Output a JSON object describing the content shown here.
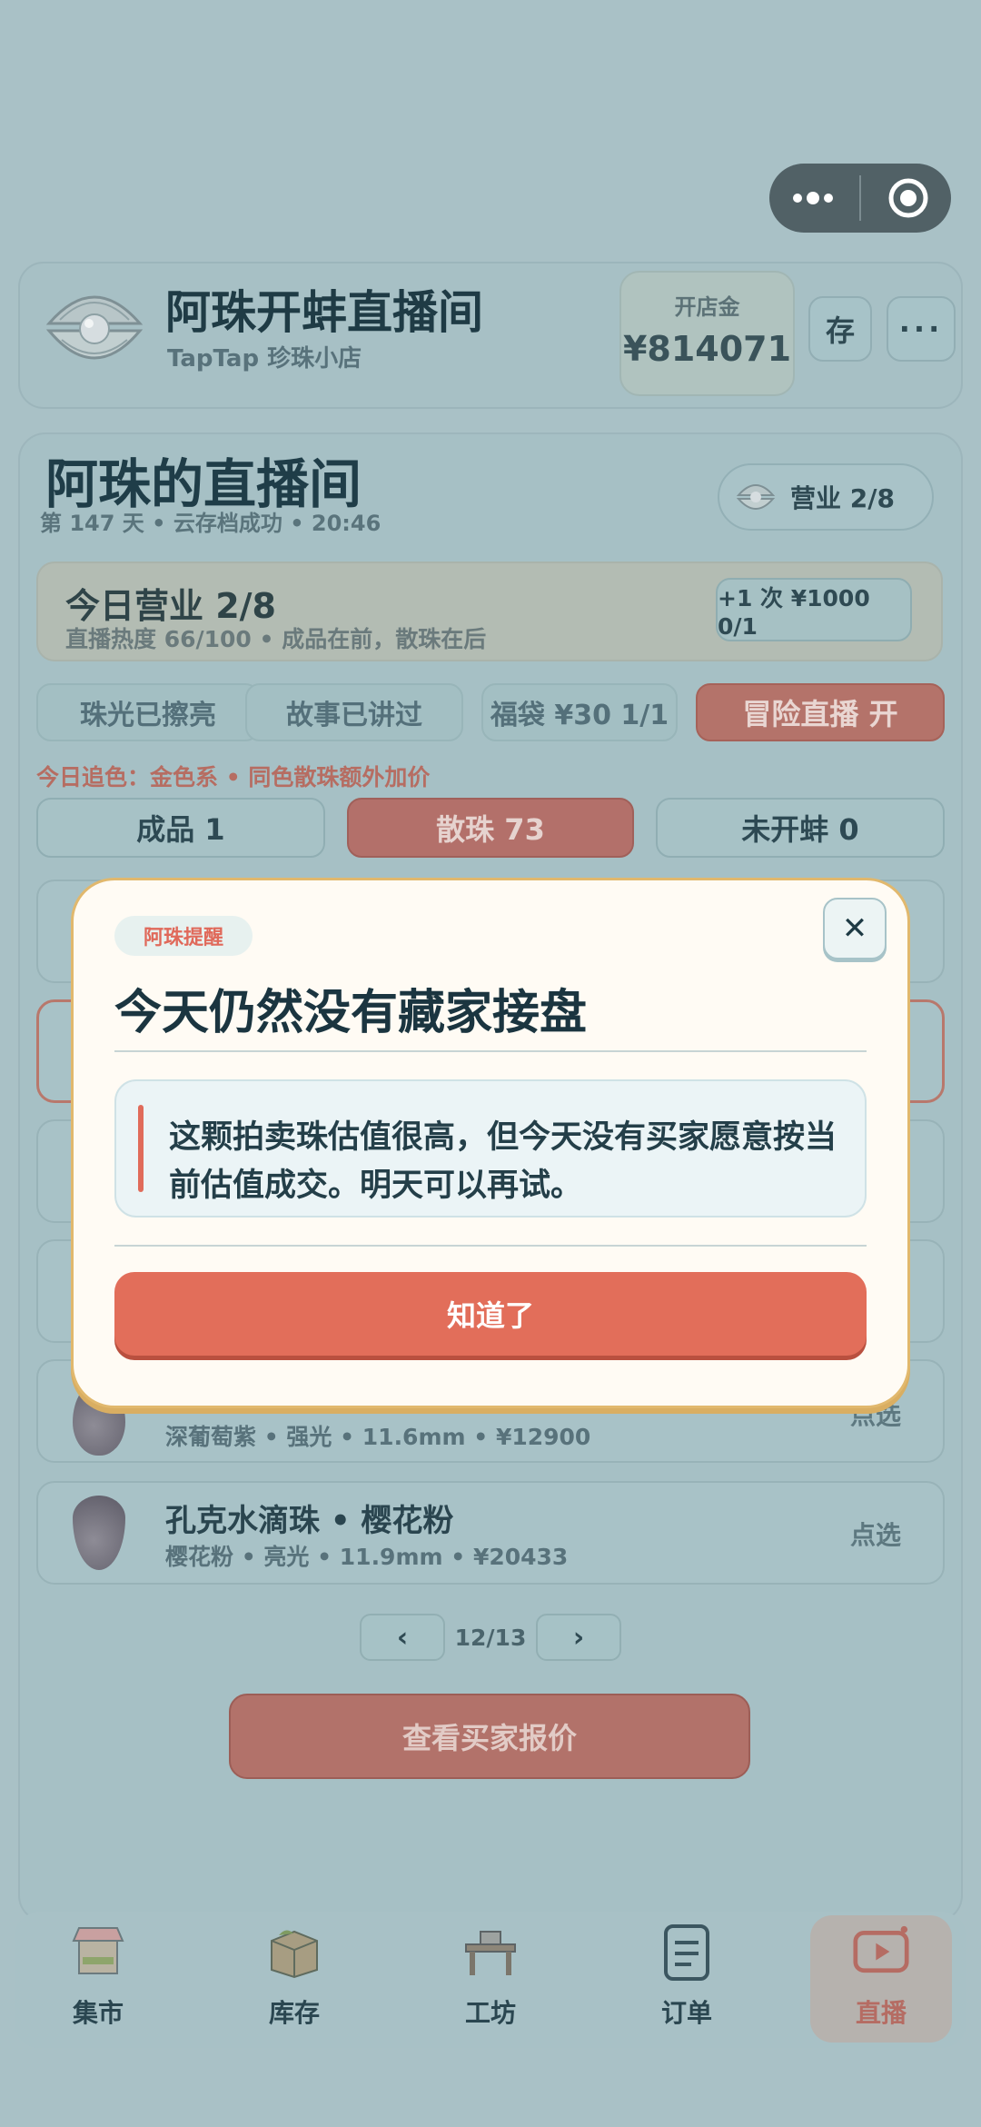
{
  "header": {
    "app_title": "阿珠开蚌直播间",
    "app_subtitle": "TapTap 珍珠小店",
    "fund_label": "开店金",
    "fund_value": "¥814071",
    "save_label": "存",
    "more_label": "···"
  },
  "room": {
    "title": "阿珠的直播间",
    "meta": "第 147 天 • 云存档成功 • 20:46",
    "business_badge": "营业 2/8"
  },
  "today": {
    "title": "今日营业 2/8",
    "subtitle": "直播热度 66/100 • 成品在前，散珠在后",
    "extra_button": "+1 次 ¥1000 0/1"
  },
  "actions": {
    "polish": "珠光已擦亮",
    "story": "故事已讲过",
    "lucky_bag": "福袋 ¥30 1/1",
    "adventure": "冒险直播 开"
  },
  "chase_note": "今日追色：金色系 • 同色散珠额外加价",
  "tabs": {
    "finished": "成品 1",
    "loose": "散珠 73",
    "unopened": "未开蚌 0"
  },
  "list": [
    {
      "name": "",
      "meta": "深葡萄紫 • 强光 • 11.6mm • ¥12900",
      "action": "点选"
    },
    {
      "name": "孔克水滴珠 • 樱花粉",
      "meta": "樱花粉 • 亮光 • 11.9mm • ¥20433",
      "action": "点选"
    }
  ],
  "pager": {
    "prev": "‹",
    "next": "›",
    "indicator": "12/13"
  },
  "offers_button": "查看买家报价",
  "nav": {
    "market": "集市",
    "inventory": "库存",
    "workshop": "工坊",
    "orders": "订单",
    "live": "直播"
  },
  "modal": {
    "tag": "阿珠提醒",
    "title": "今天仍然没有藏家接盘",
    "message": "这颗拍卖珠估值很高，但今天没有买家愿意按当前估值成交。明天可以再试。",
    "ok": "知道了",
    "close": "✕"
  },
  "colors": {
    "accent": "#e26e5a",
    "modal_border": "#e1b86d",
    "dim_background": "#a9c1c6"
  }
}
